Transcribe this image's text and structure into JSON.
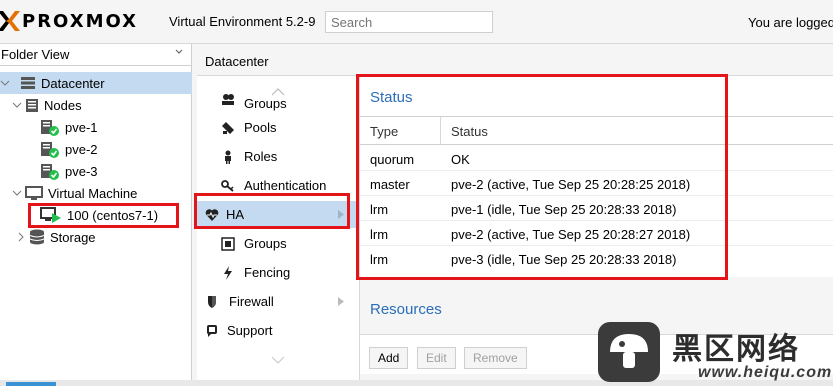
{
  "header": {
    "logo_text": "PROXMOX",
    "version": "Virtual Environment 5.2-9",
    "search_placeholder": "Search",
    "user_text": "You are logged"
  },
  "left_panel": {
    "view_selector": "Folder View",
    "tree": [
      {
        "label": "Datacenter",
        "icon": "datacenter-icon"
      },
      {
        "label": "Nodes",
        "icon": "nodes-icon"
      },
      {
        "label": "pve-1",
        "icon": "server-online-icon"
      },
      {
        "label": "pve-2",
        "icon": "server-online-icon"
      },
      {
        "label": "pve-3",
        "icon": "server-online-icon"
      },
      {
        "label": "Virtual Machine",
        "icon": "monitor-icon"
      },
      {
        "label": "100 (centos7-1)",
        "icon": "vm-running-icon"
      },
      {
        "label": "Storage",
        "icon": "database-icon"
      }
    ]
  },
  "breadcrumb": "Datacenter",
  "nav": {
    "items": [
      {
        "label": "Groups",
        "icon": "groups-icon"
      },
      {
        "label": "Pools",
        "icon": "pools-icon"
      },
      {
        "label": "Roles",
        "icon": "roles-icon"
      },
      {
        "label": "Authentication",
        "icon": "key-icon"
      },
      {
        "label": "HA",
        "icon": "heartbeat-icon"
      },
      {
        "label": "Groups",
        "icon": "ha-groups-icon"
      },
      {
        "label": "Fencing",
        "icon": "fencing-icon"
      },
      {
        "label": "Firewall",
        "icon": "shield-icon"
      },
      {
        "label": "Support",
        "icon": "support-icon"
      }
    ]
  },
  "status": {
    "title": "Status",
    "columns": [
      "Type",
      "Status"
    ],
    "rows": [
      {
        "type": "quorum",
        "status": "OK"
      },
      {
        "type": "master",
        "status": "pve-2 (active, Tue Sep 25 20:28:25 2018)"
      },
      {
        "type": "lrm",
        "status": "pve-1 (idle, Tue Sep 25 20:28:33 2018)"
      },
      {
        "type": "lrm",
        "status": "pve-2 (active, Tue Sep 25 20:28:27 2018)"
      },
      {
        "type": "lrm",
        "status": "pve-3 (idle, Tue Sep 25 20:28:33 2018)"
      }
    ]
  },
  "resources": {
    "title": "Resources",
    "buttons": {
      "add": "Add",
      "edit": "Edit",
      "remove": "Remove"
    }
  },
  "watermark": {
    "cn": "黑区网络",
    "url": "www.heiqu.com"
  },
  "colors": {
    "accent": "#2a6ebb",
    "selection": "#c3daf0",
    "annotation": "#e3151b",
    "logo_orange": "#e57000",
    "online_green": "#21bf4b"
  }
}
